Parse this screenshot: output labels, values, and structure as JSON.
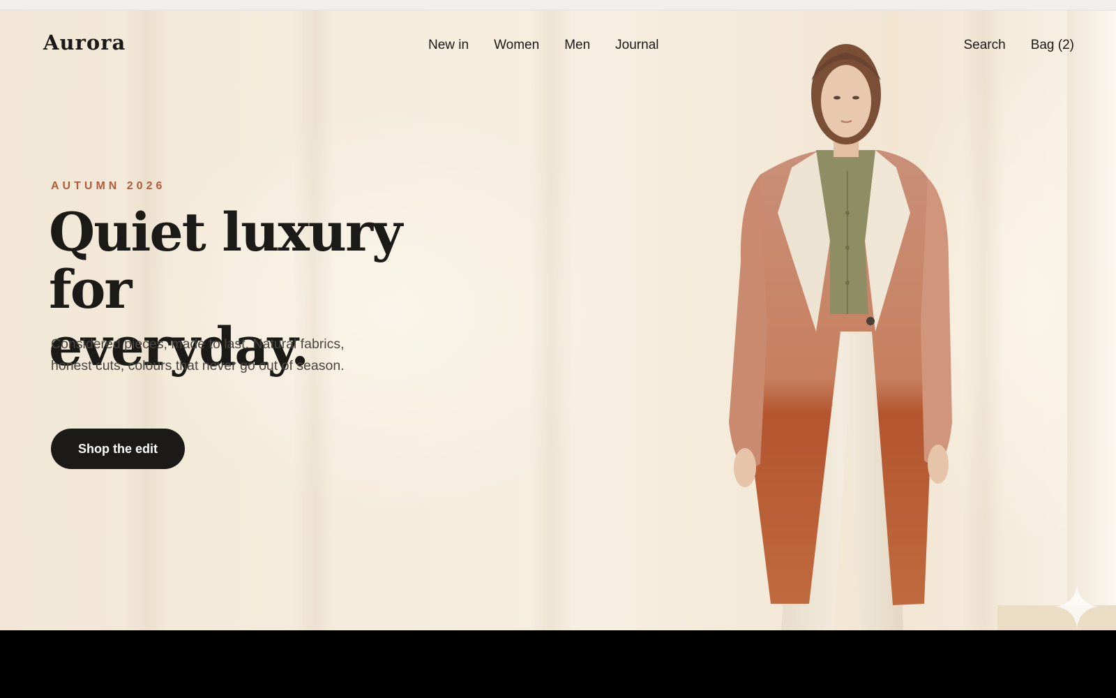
{
  "brand": {
    "name": "Aurora"
  },
  "nav": {
    "links": [
      "New in",
      "Women",
      "Men",
      "Journal"
    ],
    "utilities": [
      "Search",
      "Bag (2)"
    ]
  },
  "hero": {
    "eyebrow": "AUTUMN 2026",
    "headline_line1": "Quiet luxury for",
    "headline_line2": "everyday.",
    "subcopy": "Considered pieces, made to last. Natural fabrics, honest cuts, colours that never go out of season.",
    "cta_label": "Shop the edit"
  },
  "colors": {
    "accent": "#b35a3a",
    "ink": "#1c1a17",
    "body_text": "#4a4540",
    "background": "#f5ecdd"
  },
  "icons": {
    "hero_image": "model-in-ombre-coat-image",
    "corner_mark": "sparkle-icon"
  }
}
